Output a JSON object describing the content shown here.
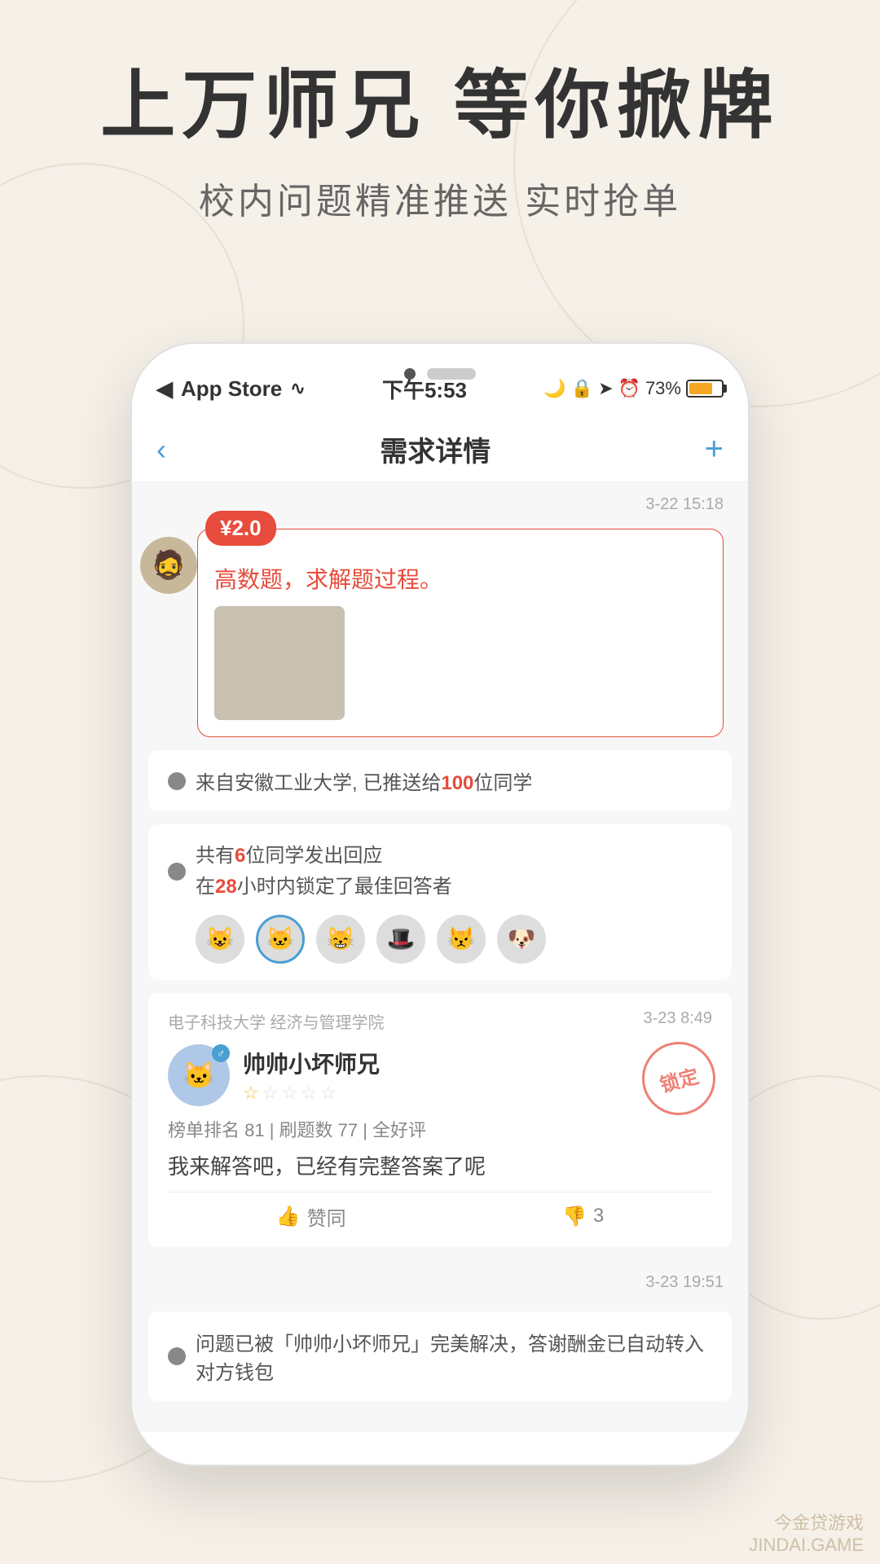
{
  "background": {
    "color": "#f5f0e8"
  },
  "header": {
    "main_title": "上万师兄 等你掀牌",
    "sub_title": "校内问题精准推送  实时抢单"
  },
  "pagination": {
    "dots": [
      "active",
      "inactive"
    ]
  },
  "status_bar": {
    "app_name": "App Store",
    "wifi_symbol": "▸",
    "time": "下午5:53",
    "battery_percent": "73%"
  },
  "nav": {
    "back_icon": "‹",
    "title": "需求详情",
    "add_icon": "+"
  },
  "question": {
    "timestamp": "3-22 15:18",
    "price": "¥2.0",
    "text": "高数题，求解题过程。",
    "has_image": true
  },
  "info_rows": [
    {
      "text_parts": [
        "来自安徽工业大学, 已推送给",
        "100",
        "位同学"
      ],
      "highlight_index": 1
    },
    {
      "line1_parts": [
        "共有",
        "6",
        "位同学发出回应"
      ],
      "line2_parts": [
        "在",
        "28",
        "小时内锁定了最佳回答者"
      ],
      "avatars": [
        "😺",
        "🐱",
        "😸",
        "🎩",
        "😾",
        "🐶"
      ]
    }
  ],
  "reply": {
    "school": "电子科技大学  经济与管理学院",
    "time": "3-23 8:49",
    "user_name": "帅帅小坏师兄",
    "gender": "♂",
    "stars": [
      true,
      false,
      false,
      false,
      false
    ],
    "stats": "榜单排名 81  |  刷题数 77  |  全好评",
    "content": "我来解答吧，已经有完整答案了呢",
    "lock_stamp": "锁定",
    "approve_label": "赞同",
    "disapprove_count": "3"
  },
  "final_message": {
    "timestamp": "3-23 19:51",
    "text_parts": [
      "问题已被「帅帅小坏师兄」完美解决，答谢酬金已自动转入对方钱包"
    ]
  },
  "watermark": {
    "line1": "今金贷游戏",
    "line2": "JINDAI.GAME"
  }
}
